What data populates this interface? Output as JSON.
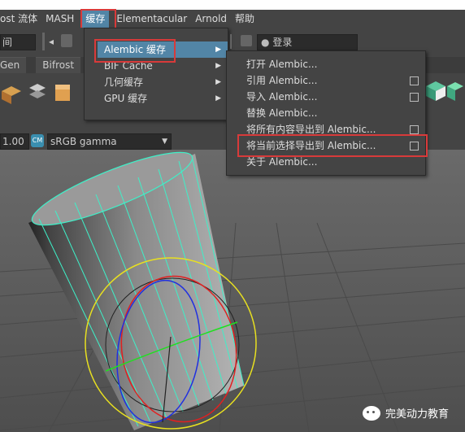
{
  "menubar": {
    "items": [
      "ost 流体",
      "MASH",
      "缓存",
      "Elementacular",
      "Arnold",
      "帮助"
    ]
  },
  "status": {
    "left_field": "间",
    "right_field": "登录"
  },
  "shelf": {
    "tabs": [
      "Gen",
      "Bifrost"
    ]
  },
  "viewport_toolbar": {
    "gamma_value": "1.00",
    "colorspace": "sRGB gamma"
  },
  "cache_menu": {
    "items": [
      {
        "label": "Alembic 缓存",
        "has_submenu": true
      },
      {
        "label": "BIF Cache",
        "has_submenu": true
      },
      {
        "label": "几何缓存",
        "has_submenu": true
      },
      {
        "label": "GPU 缓存",
        "has_submenu": true
      }
    ]
  },
  "alembic_submenu": {
    "items": [
      {
        "label": "打开 Alembic...",
        "option_box": false
      },
      {
        "label": "引用 Alembic...",
        "option_box": true
      },
      {
        "label": "导入 Alembic...",
        "option_box": true
      },
      {
        "label": "替换 Alembic...",
        "option_box": false
      },
      {
        "label": "将所有内容导出到 Alembic...",
        "option_box": true
      },
      {
        "label": "将当前选择导出到 Alembic...",
        "option_box": true
      },
      {
        "label": "关于 Alembic...",
        "option_box": false
      }
    ]
  },
  "watermark": {
    "text": "完美动力教育"
  },
  "colors": {
    "highlight": "#5285a6",
    "annotation_red": "#d83a3a",
    "wireframe": "#3ef0c8"
  }
}
